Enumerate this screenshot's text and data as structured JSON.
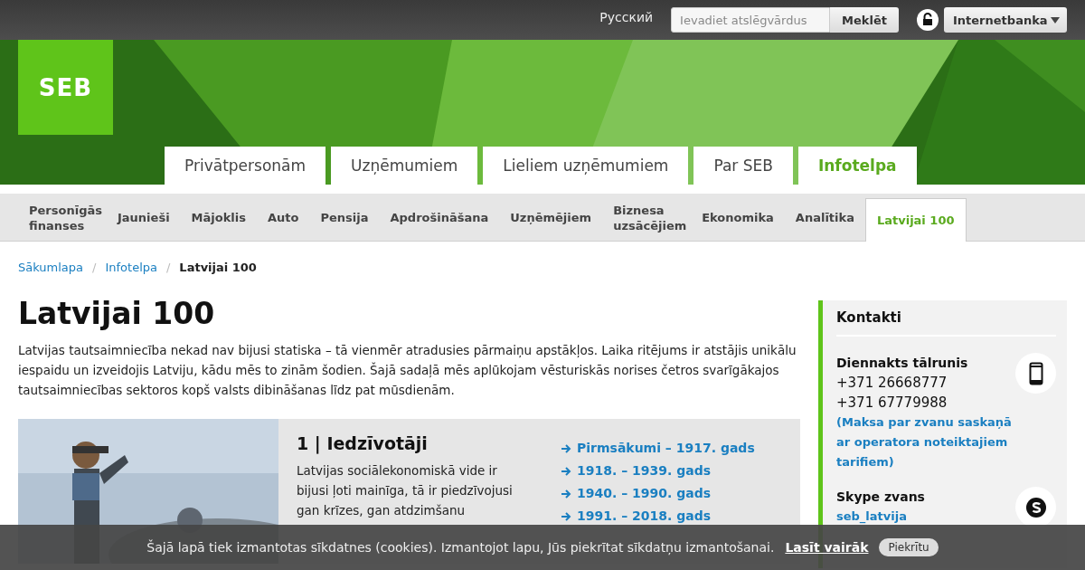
{
  "top_bar": {
    "language": "Русский",
    "search": {
      "placeholder": "Ievadiet atslēgvārdus",
      "button": "Meklēt"
    },
    "bank_menu": "Internetbanka"
  },
  "logo": "SEB",
  "main_nav": [
    {
      "label": "Privātpersonām",
      "selected": false
    },
    {
      "label": "Uzņēmumiem",
      "selected": false
    },
    {
      "label": "Lieliem uzņēmumiem",
      "selected": false
    },
    {
      "label": "Par SEB",
      "selected": false
    },
    {
      "label": "Infotelpa",
      "selected": true
    }
  ],
  "sub_nav": [
    {
      "label": "Personīgās finanses",
      "selected": false
    },
    {
      "label": "Jaunieši",
      "selected": false
    },
    {
      "label": "Mājoklis",
      "selected": false
    },
    {
      "label": "Auto",
      "selected": false
    },
    {
      "label": "Pensija",
      "selected": false
    },
    {
      "label": "Apdrošināšana",
      "selected": false
    },
    {
      "label": "Uzņēmējiem",
      "selected": false
    },
    {
      "label": "Biznesa uzsācējiem",
      "selected": false
    },
    {
      "label": "Ekonomika",
      "selected": false
    },
    {
      "label": "Analītika",
      "selected": false
    },
    {
      "label": "Latvijai 100",
      "selected": true
    }
  ],
  "breadcrumb_separator": "/",
  "breadcrumb": [
    {
      "label": "Sākumlapa",
      "current": false
    },
    {
      "label": "Infotelpa",
      "current": false
    },
    {
      "label": "Latvijai 100",
      "current": true
    }
  ],
  "title": "Latvijai 100",
  "intro": "Latvijas tautsaimniecība nekad nav bijusi statiska – tā vienmēr atradusies pārmaiņu apstākļos. Laika ritējums ir atstājis unikālu iespaidu un izveidojis Latviju, kādu mēs to zinām šodien. Šajā sadaļā mēs aplūkojam vēsturiskās norises četros svarīgākajos tautsaimniecības sektoros kopš valsts dibināšanas līdz pat mūsdienām.",
  "card": {
    "image": {
      "kind": "picture"
    },
    "heading": "1 | Iedzīvotāji",
    "text": "Latvijas sociālekonomiskā vide ir bijusi ļoti mainīga, tā ir piedzīvojusi gan krīzes, gan atdzimšanu",
    "links": [
      "Pirmsākumi – 1917. gads",
      "1918. – 1939. gads",
      "1940. – 1990. gads",
      "1991. – 2018. gads"
    ]
  },
  "contacts": {
    "title": "Kontakti",
    "items": [
      {
        "kind": "phone",
        "label": "Diennakts tālrunis",
        "lines": [
          "+371 26668777",
          "+371 67779988"
        ],
        "link": "(Maksa par zvanu saskaņā ar operatora noteiktajiem tarifiem)"
      },
      {
        "kind": "skype",
        "label": "Skype zvans",
        "link": "seb_latvija"
      }
    ]
  },
  "cookie_bar": {
    "text": "Šajā lapā tiek izmantotas sīkdatnes (cookies). Izmantojot lapu, Jūs piekrītat sīkdatņu izmantošanai.",
    "link": "Lasīt vairāk",
    "button": "Piekrītu"
  }
}
